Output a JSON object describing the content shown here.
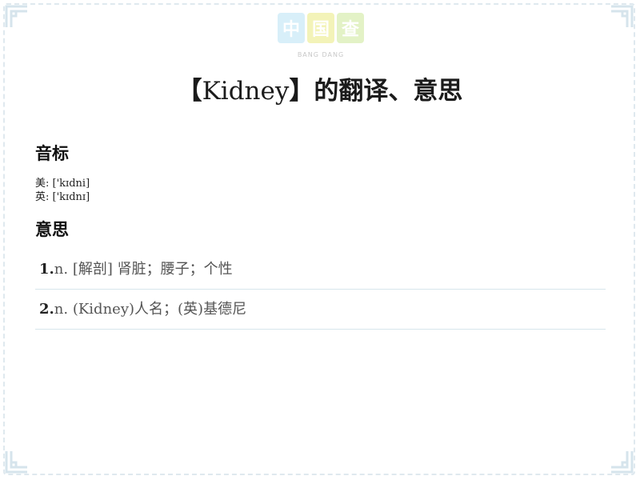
{
  "logo": {
    "chars": [
      "中",
      "国",
      "查"
    ],
    "sub": "BANG DANG"
  },
  "title": {
    "open": "【",
    "word": "Kidney",
    "close": "】",
    "suffix": "的翻译、意思"
  },
  "phonetics": {
    "heading": "音标",
    "us_label": "美:",
    "us": "['kɪdni]",
    "uk_label": "英:",
    "uk": "['kɪdnɪ]"
  },
  "meanings": {
    "heading": "意思",
    "items": [
      {
        "num": "1.",
        "text": "n. [解剖] 肾脏；腰子；个性"
      },
      {
        "num": "2.",
        "text": "n. (Kidney)人名；(英)基德尼"
      }
    ]
  },
  "colors": {
    "frame": "#dfe9ef",
    "divider": "#d7e6ec"
  }
}
